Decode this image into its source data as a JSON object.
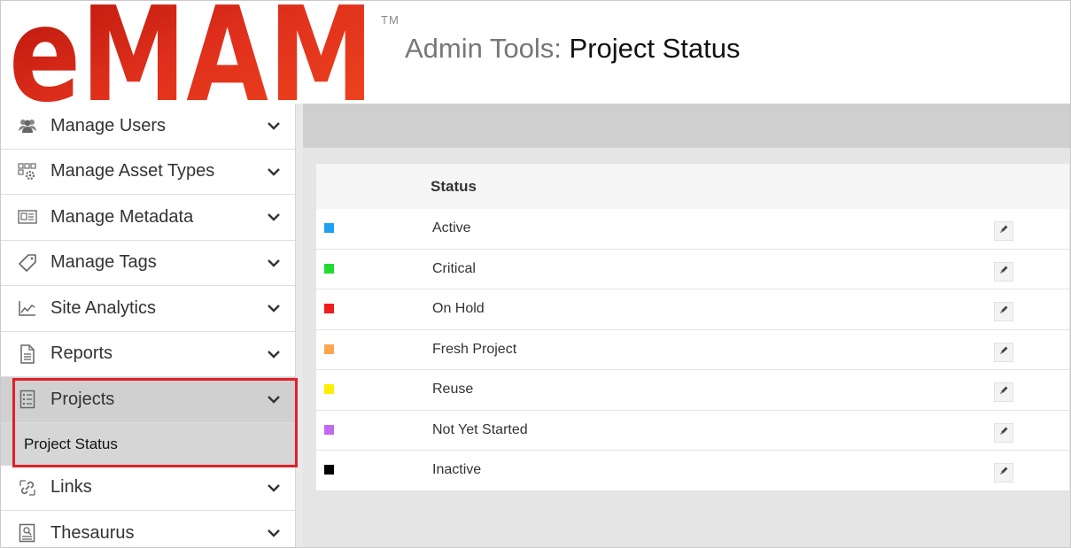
{
  "header": {
    "logo_text": "eMAM",
    "tm": "TM",
    "title_prefix": "Admin Tools: ",
    "title_page": "Project Status"
  },
  "sidebar": {
    "items": [
      {
        "label": "Manage Users",
        "icon": "users-icon"
      },
      {
        "label": "Manage Asset Types",
        "icon": "asset-types-icon"
      },
      {
        "label": "Manage Metadata",
        "icon": "metadata-icon"
      },
      {
        "label": "Manage Tags",
        "icon": "tag-icon"
      },
      {
        "label": "Site Analytics",
        "icon": "analytics-icon"
      },
      {
        "label": "Reports",
        "icon": "report-icon"
      },
      {
        "label": "Projects",
        "icon": "projects-icon"
      },
      {
        "label": "Links",
        "icon": "links-icon"
      },
      {
        "label": "Thesaurus",
        "icon": "thesaurus-icon"
      }
    ],
    "sub_items": [
      {
        "label": "Project Status"
      }
    ]
  },
  "table": {
    "header": "Status",
    "rows": [
      {
        "name": "Active",
        "color": "#1ea1f2"
      },
      {
        "name": "Critical",
        "color": "#1fdc2e"
      },
      {
        "name": "On Hold",
        "color": "#f01c1c"
      },
      {
        "name": "Fresh Project",
        "color": "#ffa64d"
      },
      {
        "name": "Reuse",
        "color": "#ffee00"
      },
      {
        "name": "Not Yet Started",
        "color": "#c06aef"
      },
      {
        "name": "Inactive",
        "color": "#000000"
      }
    ]
  },
  "colors": {
    "logo_red": "#d61f12",
    "highlight": "#e0202a"
  }
}
